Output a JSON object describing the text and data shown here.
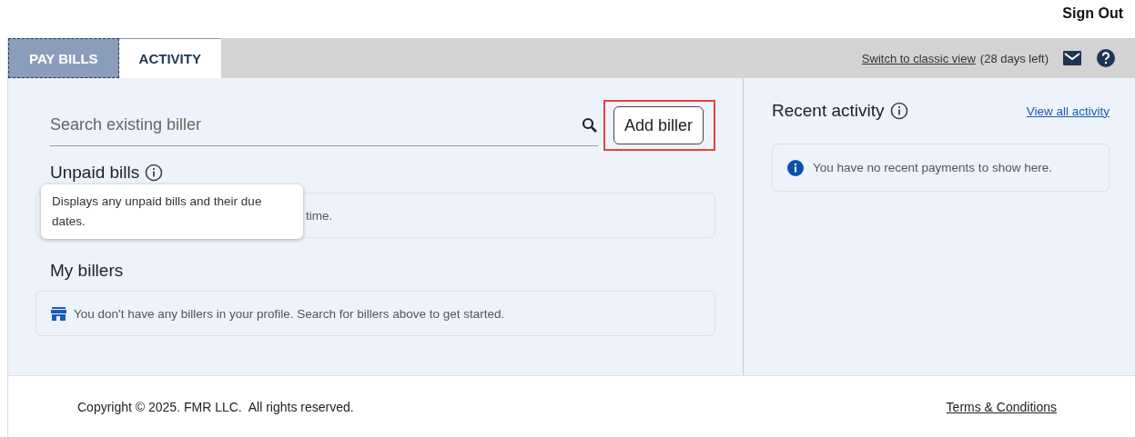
{
  "header": {
    "sign_out": "Sign Out"
  },
  "tabs": [
    {
      "label": "PAY BILLS",
      "selected": true
    },
    {
      "label": "ACTIVITY",
      "selected": false
    }
  ],
  "toolbar": {
    "classic_link": "Switch to classic view",
    "days_left": "(28 days left)"
  },
  "search": {
    "placeholder": "Search existing biller"
  },
  "add_biller": {
    "label": "Add biller",
    "highlighted": true
  },
  "unpaid": {
    "title": "Unpaid bills",
    "tooltip": "Displays any unpaid bills and their due dates.",
    "message": "time."
  },
  "billers": {
    "title": "My billers",
    "message": "You don't have any billers in your profile. Search for billers above to get started."
  },
  "recent": {
    "title": "Recent activity",
    "link": "View all activity",
    "message": "You have no recent payments to show here."
  },
  "footer": {
    "copyright": "Copyright © 2025. FMR LLC.  All rights reserved.",
    "terms": "Terms & Conditions"
  }
}
